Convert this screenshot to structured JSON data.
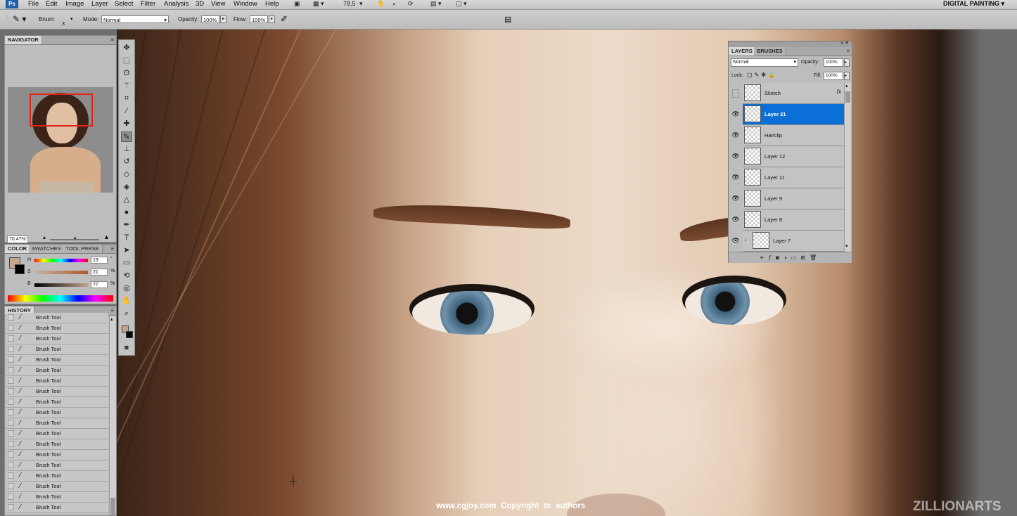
{
  "menu": {
    "logo": "Ps",
    "items": [
      "File",
      "Edit",
      "Image",
      "Layer",
      "Select",
      "Filter",
      "Analysis",
      "3D",
      "View",
      "Window",
      "Help"
    ],
    "zoom_value": "78,5",
    "workspace": "DIGITAL PAINTING"
  },
  "options": {
    "brush_label": "Brush:",
    "brush_size": "3",
    "mode_label": "Mode:",
    "mode_value": "Normal",
    "opacity_label": "Opacity:",
    "opacity_value": "100%",
    "flow_label": "Flow:",
    "flow_value": "100%"
  },
  "navigator": {
    "tab": "NAVIGATOR",
    "zoom": "70.47%"
  },
  "color_panel": {
    "tabs": [
      "COLOR",
      "SWATCHES",
      "TOOL PRESE"
    ],
    "h_label": "H",
    "h_value": "19",
    "h_unit": "°",
    "s_label": "S",
    "s_value": "21",
    "s_unit": "%",
    "b_label": "B",
    "b_value": "77",
    "b_unit": "%",
    "foreground_color": "#c4a58c",
    "background_color": "#000000"
  },
  "history": {
    "tab": "HISTORY",
    "items": [
      "Brush Tool",
      "Brush Tool",
      "Brush Tool",
      "Brush Tool",
      "Brush Tool",
      "Brush Tool",
      "Brush Tool",
      "Brush Tool",
      "Brush Tool",
      "Brush Tool",
      "Brush Tool",
      "Brush Tool",
      "Brush Tool",
      "Brush Tool",
      "Brush Tool",
      "Brush Tool",
      "Brush Tool",
      "Brush Tool",
      "Brush Tool"
    ]
  },
  "layers": {
    "tabs": [
      "LAYERS",
      "BRUSHES"
    ],
    "blend_mode": "Normal",
    "opacity_label": "Opacity:",
    "opacity_value": "100%",
    "lock_label": "Lock:",
    "fill_label": "Fill:",
    "fill_value": "100%",
    "fx_label": "fx",
    "items": [
      {
        "name": "Sketch",
        "visible": false,
        "selected": false
      },
      {
        "name": "Layer 21",
        "visible": true,
        "selected": true
      },
      {
        "name": "Hairclip",
        "visible": true,
        "selected": false
      },
      {
        "name": "Layer 12",
        "visible": true,
        "selected": false
      },
      {
        "name": "Layer 11",
        "visible": true,
        "selected": false
      },
      {
        "name": "Layer 9",
        "visible": true,
        "selected": false
      },
      {
        "name": "Layer 8",
        "visible": true,
        "selected": false
      },
      {
        "name": "Layer 7",
        "visible": true,
        "selected": false
      }
    ]
  },
  "watermark": {
    "copyright": "www.cgjoy.com  Copyright  to  authors",
    "brand": "ZILLIONARTS"
  },
  "colors": {
    "selection": "#0a6fd6",
    "panel_bg": "#bdbdbd"
  }
}
